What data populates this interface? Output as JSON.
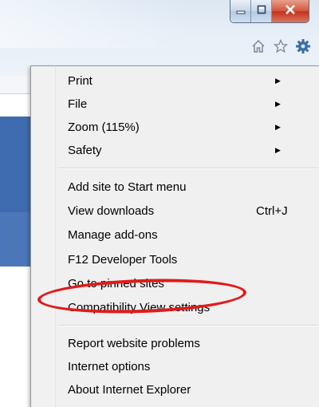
{
  "window": {
    "caption_buttons": [
      {
        "name": "minimize",
        "icon": "minimize-icon"
      },
      {
        "name": "maximize",
        "icon": "maximize-icon"
      },
      {
        "name": "close",
        "icon": "close-icon"
      }
    ],
    "toolbar_icons": [
      "home-icon",
      "star-icon",
      "gear-icon"
    ]
  },
  "menu": {
    "group1": [
      {
        "label": "Print",
        "submenu": true
      },
      {
        "label": "File",
        "submenu": true
      },
      {
        "label": "Zoom (115%)",
        "submenu": true
      },
      {
        "label": "Safety",
        "submenu": true
      }
    ],
    "group2": [
      {
        "label": "Add site to Start menu"
      },
      {
        "label": "View downloads",
        "shortcut": "Ctrl+J"
      },
      {
        "label": "Manage add-ons"
      },
      {
        "label": "F12 Developer Tools"
      },
      {
        "label": "Go to pinned sites"
      },
      {
        "label": "Compatibility View settings",
        "highlighted": true
      }
    ],
    "group3": [
      {
        "label": "Report website problems"
      },
      {
        "label": "Internet options"
      },
      {
        "label": "About Internet Explorer"
      }
    ]
  },
  "colors": {
    "highlight_ring": "#e01b1b",
    "page_blue": "#3f6cb0",
    "close_button": "#c4311a"
  }
}
